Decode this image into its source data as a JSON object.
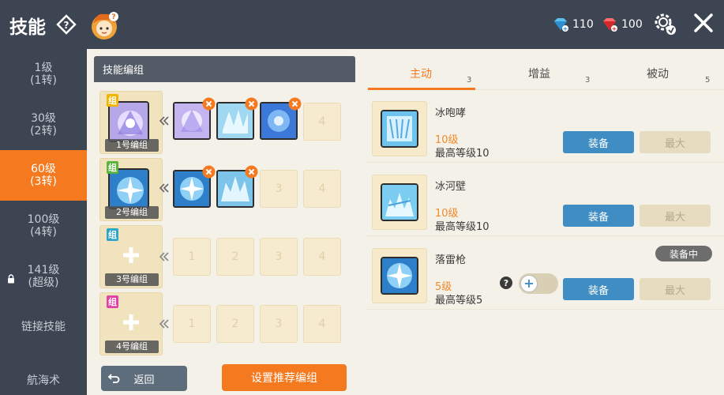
{
  "header": {
    "title": "技能",
    "currency": [
      {
        "icon": "blue-diamond-icon",
        "value": "110"
      },
      {
        "icon": "red-diamond-icon",
        "value": "100"
      }
    ]
  },
  "sidebar": {
    "items": [
      {
        "line1": "1级",
        "line2": "(1转)"
      },
      {
        "line1": "30级",
        "line2": "(2转)"
      },
      {
        "line1": "60级",
        "line2": "(3转)"
      },
      {
        "line1": "100级",
        "line2": "(4转)"
      },
      {
        "line1": "141级",
        "line2": "(超级)"
      },
      {
        "line1": "链接技能",
        "line2": ""
      },
      {
        "line1": "航海术",
        "line2": ""
      }
    ],
    "active_index": 2
  },
  "groups": {
    "header": "技能编组",
    "tag": "组",
    "rows": [
      {
        "name": "1号编组",
        "tag_color": "#f2b400",
        "filled": 3,
        "slots": [
          "",
          "",
          "",
          "4"
        ]
      },
      {
        "name": "2号编组",
        "tag_color": "#5ab43c",
        "filled": 2,
        "slots": [
          "",
          "",
          "3",
          "4"
        ]
      },
      {
        "name": "3号编组",
        "tag_color": "#2ca5c8",
        "filled": 0,
        "slots": [
          "1",
          "2",
          "3",
          "4"
        ]
      },
      {
        "name": "4号编组",
        "tag_color": "#e23fa8",
        "filled": 0,
        "slots": [
          "1",
          "2",
          "3",
          "4"
        ]
      }
    ],
    "back_label": "返回",
    "recommend_label": "设置推荐编组"
  },
  "tabs": [
    {
      "label": "主动",
      "count": "3"
    },
    {
      "label": "增益",
      "count": "3"
    },
    {
      "label": "被动",
      "count": "5"
    }
  ],
  "skills": [
    {
      "name": "冰咆哮",
      "level": "10级",
      "max": "最高等级10",
      "equip": "装备",
      "max_btn": "最大"
    },
    {
      "name": "冰河壁",
      "level": "10级",
      "max": "最高等级10",
      "equip": "装备",
      "max_btn": "最大"
    },
    {
      "name": "落雷枪",
      "level": "5级",
      "max": "最高等级5",
      "equip": "装备",
      "max_btn": "最大",
      "badge": "装备中",
      "toggle_symbol": "+"
    }
  ],
  "colors": {
    "accent": "#f57a1f",
    "primary_button": "#3f8dc2",
    "sidebar": "#3d4553"
  }
}
